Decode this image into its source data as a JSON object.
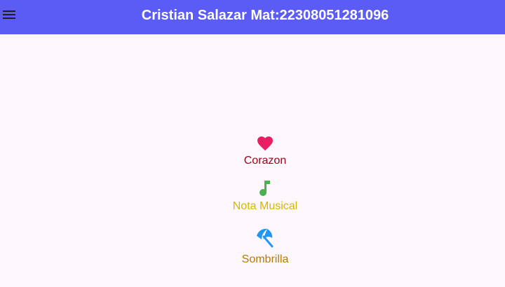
{
  "app_bar": {
    "title": "Cristian Salazar Mat:22308051281096",
    "menu_icon": "menu-icon",
    "background": "#5b5cf6"
  },
  "items": [
    {
      "icon": "heart-icon",
      "icon_color": "#e91e63",
      "label": "Corazon",
      "label_color": "#a0001a"
    },
    {
      "icon": "music-note-icon",
      "icon_color": "#4caf50",
      "label": "Nota Musical",
      "label_color": "#d4b800"
    },
    {
      "icon": "beach-umbrella-icon",
      "icon_color": "#2196f3",
      "label": "Sombrilla",
      "label_color": "#b87a00"
    }
  ]
}
